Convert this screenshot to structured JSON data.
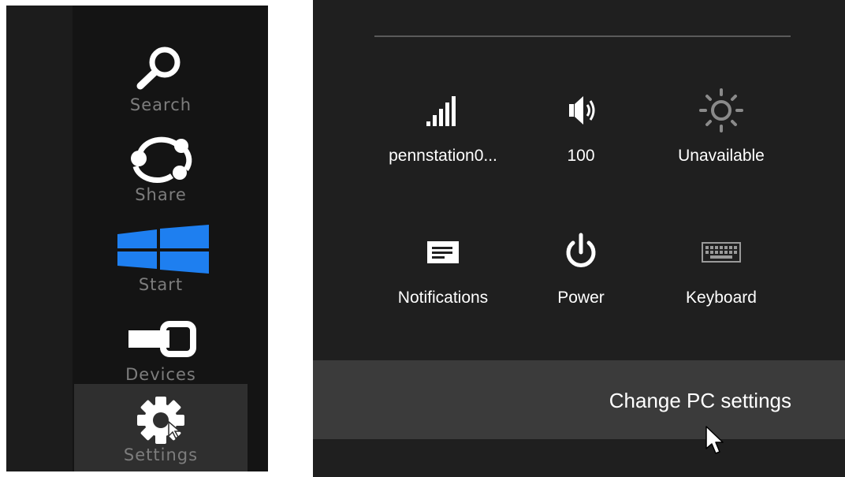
{
  "charms": [
    {
      "label": "Search",
      "icon": "search-icon"
    },
    {
      "label": "Share",
      "icon": "share-icon"
    },
    {
      "label": "Start",
      "icon": "windows-logo-icon"
    },
    {
      "label": "Devices",
      "icon": "devices-icon"
    },
    {
      "label": "Settings",
      "icon": "gear-icon",
      "active": true
    }
  ],
  "settings": {
    "network_label": "pennstation0...",
    "volume_label": "100",
    "brightness_label": "Unavailable",
    "notifications_label": "Notifications",
    "power_label": "Power",
    "keyboard_label": "Keyboard",
    "change_pc_settings": "Change PC settings"
  },
  "colors": {
    "accent": "#1e7ff0",
    "pane_bg": "#1f1f1f",
    "charm_label": "#7d7d7d"
  }
}
